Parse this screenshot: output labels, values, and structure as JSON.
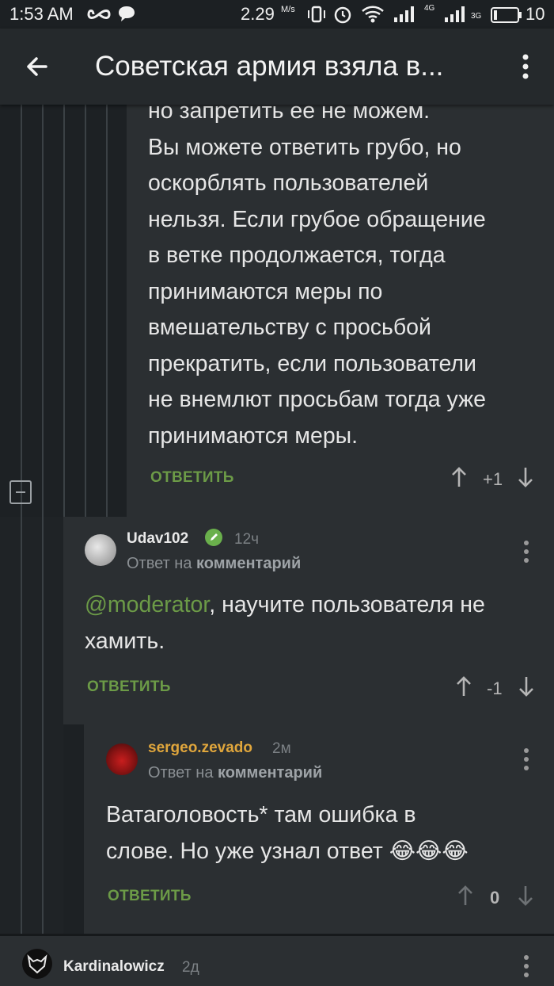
{
  "status_bar": {
    "time": "1:53 AM",
    "speed": "2.29",
    "speed_unit": "M/s",
    "battery": "10",
    "net1": "4G",
    "net2": "3G"
  },
  "header": {
    "title": "Советская армия взяла в..."
  },
  "comments": [
    {
      "text_lines": [
        "но запретить ее не можем.",
        "Вы можете ответить грубо, но",
        "оскорблять пользователей",
        "нельзя. Если грубое обращение",
        "в ветке продолжается, тогда",
        "принимаются меры по",
        "вмешательству с просьбой",
        "прекратить, если пользователи",
        "не внемлют просьбам тогда уже",
        "принимаются меры."
      ],
      "reply_label": "ОТВЕТИТЬ",
      "score": "+1"
    },
    {
      "author": "Udav102",
      "time": "12ч",
      "sub_prefix": "Ответ на",
      "sub_link": "комментарий",
      "mention": "@moderator",
      "text_after_mention": ", научите пользователя не",
      "text_line2": "хамить.",
      "reply_label": "ОТВЕТИТЬ",
      "score": "-1"
    },
    {
      "author": "sergeo.zevado",
      "time": "2м",
      "sub_prefix": "Ответ на",
      "sub_link": "комментарий",
      "text_line1": "Ватаголовость* там ошибка в",
      "text_line2": "слове. Но уже узнал ответ",
      "emoji": "😂😂😂",
      "reply_label": "ОТВЕТИТЬ",
      "score": "0"
    },
    {
      "author": "Kardinalowicz",
      "time": "2д"
    }
  ],
  "colors": {
    "background": "#1f2326",
    "panel": "#2b2f32",
    "accent_green": "#6c9b47",
    "author_gold": "#e0a63c"
  },
  "icons": [
    "back-arrow-icon",
    "more-vert-icon",
    "vote-up-icon",
    "vote-down-icon",
    "collapse-icon",
    "verified-pencil-icon"
  ]
}
